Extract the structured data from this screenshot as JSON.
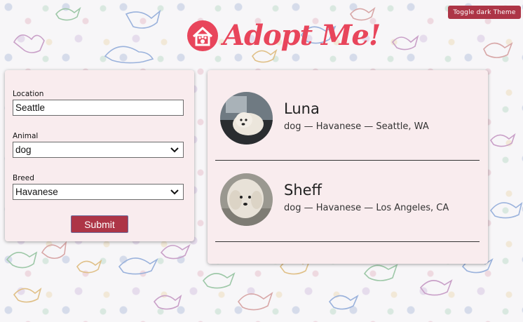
{
  "header": {
    "theme_toggle_label": "Toggle dark Theme",
    "logo_text": "Adopt Me!"
  },
  "search": {
    "location_label": "Location",
    "location_value": "Seattle",
    "animal_label": "Animal",
    "animal_value": "dog",
    "breed_label": "Breed",
    "breed_value": "Havanese",
    "submit_label": "Submit"
  },
  "results": [
    {
      "name": "Luna",
      "description": "dog — Havanese — Seattle, WA",
      "photo_icon": "white-dog-photo"
    },
    {
      "name": "Sheff",
      "description": "dog — Havanese — Los Angeles, CA",
      "photo_icon": "white-dog-photo"
    }
  ],
  "colors": {
    "accent": "#ad3546",
    "logo": "#e8455b",
    "panel": "#f9ecee"
  }
}
